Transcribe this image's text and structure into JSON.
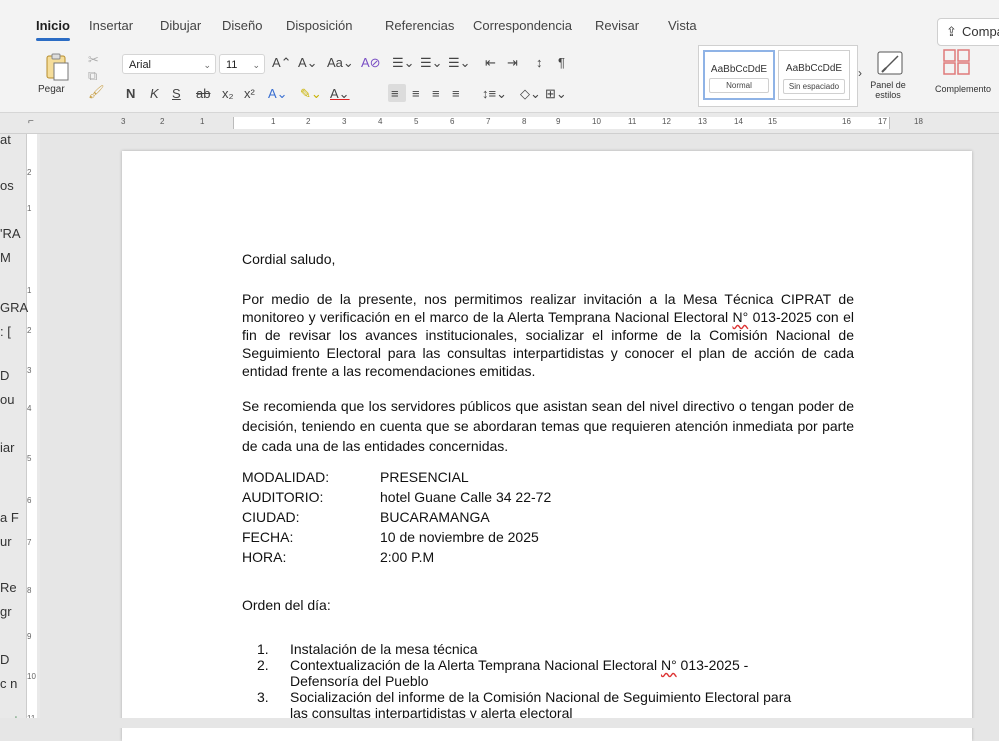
{
  "ribbon": {
    "tabs": [
      "Inicio",
      "Insertar",
      "Dibujar",
      "Diseño",
      "Disposición",
      "Referencias",
      "Correspondencia",
      "Revisar",
      "Vista"
    ],
    "active_tab": "Inicio",
    "share_label": "Compa",
    "paste_label": "Pegar",
    "font_name": "Arial",
    "font_size": "11",
    "format_buttons": [
      "N",
      "K",
      "S"
    ],
    "styles": [
      {
        "sample": "AaBbCcDdE",
        "name": "Normal"
      },
      {
        "sample": "AaBbCcDdE",
        "name": "Sin espaciado"
      }
    ],
    "styles_panel_label": "Panel de estilos",
    "complements_label": "Complemento"
  },
  "ruler": {
    "numbers": [
      "3",
      "2",
      "1",
      "1",
      "2",
      "3",
      "4",
      "5",
      "6",
      "7",
      "8",
      "9",
      "10",
      "11",
      "12",
      "13",
      "14",
      "15",
      "16",
      "17",
      "18"
    ]
  },
  "vruler": {
    "numbers": [
      "2",
      "1",
      "1",
      "2",
      "3",
      "4",
      "5",
      "6",
      "7",
      "8",
      "9",
      "10",
      "11"
    ]
  },
  "sidebar_fragments": [
    "at",
    "os",
    "'RA",
    "M",
    "GRA",
    ": [",
    "D",
    "ou",
    "iar",
    "a F",
    "ur",
    "Re",
    "gr",
    "D",
    "c n",
    "nei"
  ],
  "document": {
    "greeting": "Cordial saludo,",
    "para1": "Por medio de la presente, nos permitimos realizar invitación a la Mesa Técnica CIPRAT de monitoreo y verificación en el marco de la Alerta Temprana Nacional Electoral N° 013-2025 con el fin de revisar los avances institucionales, socializar el informe de la Comisión Nacional de Seguimiento Electoral para las consultas interpartidistas y conocer el plan de acción de cada entidad frente a las recomendaciones emitidas.",
    "para2": "Se recomienda que los servidores públicos que asistan sean del nivel directivo o tengan poder de decisión, teniendo en cuenta que se abordaran temas que requieren atención inmediata por parte de cada una de las entidades concernidas.",
    "fields": [
      {
        "label": "MODALIDAD:",
        "value": "PRESENCIAL"
      },
      {
        "label": "AUDITORIO:",
        "value": "hotel Guane Calle 34 22-72"
      },
      {
        "label": "CIUDAD:",
        "value": "BUCARAMANGA"
      },
      {
        "label": "FECHA:",
        "value": "10 de noviembre de 2025"
      },
      {
        "label": "HORA:",
        "value": "2:00 P.M"
      }
    ],
    "agenda_title": "Orden del día:",
    "agenda": [
      {
        "num": "1.",
        "lines": [
          "Instalación de la mesa técnica"
        ]
      },
      {
        "num": "2.",
        "lines": [
          "Contextualización de la Alerta Temprana Nacional Electoral N° 013-2025 -",
          "Defensoría del Pueblo"
        ]
      },
      {
        "num": "3.",
        "lines": [
          "Socialización del informe de la Comisión Nacional de Seguimiento Electoral para",
          "las consultas interpartidistas y alerta electoral"
        ]
      }
    ]
  }
}
